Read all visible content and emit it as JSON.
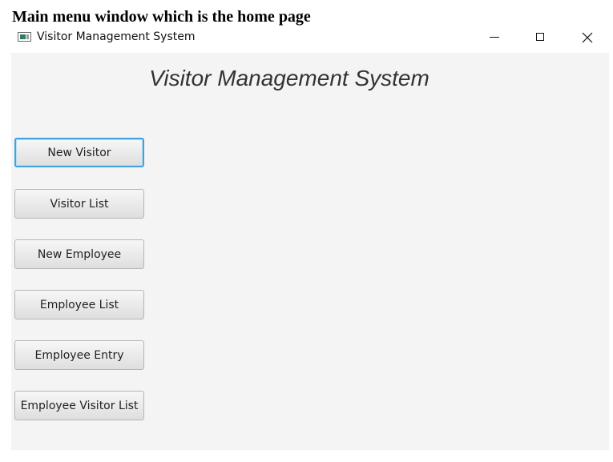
{
  "caption": "Main menu window which is the home page",
  "window": {
    "title": "Visitor Management System",
    "controls": {
      "minimize_icon": "minimize-icon",
      "maximize_icon": "maximize-icon",
      "close_icon": "close-icon"
    }
  },
  "main": {
    "heading": "Visitor Management System",
    "buttons": [
      {
        "label": "New Visitor",
        "focused": true
      },
      {
        "label": "Visitor List",
        "focused": false
      },
      {
        "label": "New Employee",
        "focused": false
      },
      {
        "label": "Employee List",
        "focused": false
      },
      {
        "label": "Employee Entry",
        "focused": false
      },
      {
        "label": "Employee Visitor List",
        "focused": false
      }
    ]
  },
  "colors": {
    "content_background": "#f4f4f4",
    "focus_ring": "#3fa3e0"
  }
}
